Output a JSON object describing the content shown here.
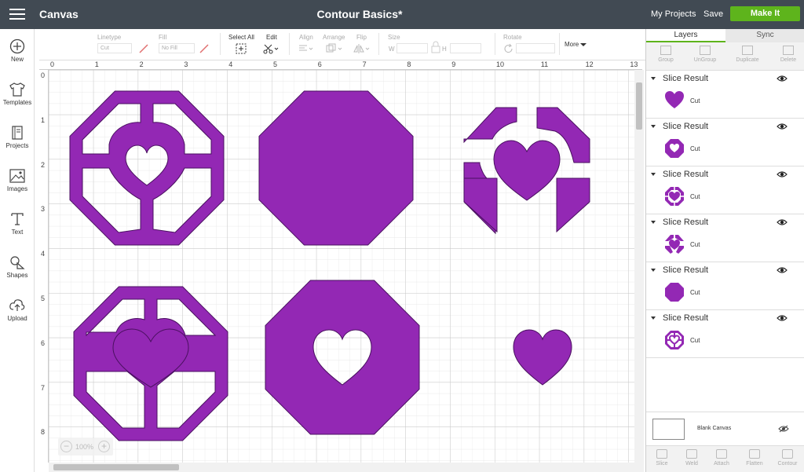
{
  "header": {
    "app_title": "Canvas",
    "project_title": "Contour Basics*",
    "my_projects": "My Projects",
    "save": "Save",
    "make_it": "Make It"
  },
  "sidebar": {
    "items": [
      {
        "label": "New",
        "icon": "plus-circle-icon"
      },
      {
        "label": "Templates",
        "icon": "shirt-icon"
      },
      {
        "label": "Projects",
        "icon": "book-icon"
      },
      {
        "label": "Images",
        "icon": "image-icon"
      },
      {
        "label": "Text",
        "icon": "text-t-icon"
      },
      {
        "label": "Shapes",
        "icon": "shapes-icon"
      },
      {
        "label": "Upload",
        "icon": "cloud-upload-icon"
      }
    ]
  },
  "toolbar": {
    "linetype_label": "Linetype",
    "linetype_value": "Cut",
    "fill_label": "Fill",
    "fill_value": "No Fill",
    "select_all": "Select All",
    "edit": "Edit",
    "align": "Align",
    "arrange": "Arrange",
    "flip": "Flip",
    "size": "Size",
    "w": "W",
    "h": "H",
    "rotate": "Rotate",
    "more": "More"
  },
  "rulers": {
    "top": [
      "0",
      "1",
      "2",
      "3",
      "4",
      "5",
      "6",
      "7",
      "8",
      "9",
      "10",
      "11",
      "12",
      "13"
    ],
    "left": [
      "0",
      "1",
      "2",
      "3",
      "4",
      "5",
      "6",
      "7",
      "8"
    ]
  },
  "zoom": {
    "value": "100%",
    "minus": "−",
    "plus": "+"
  },
  "panel": {
    "tabs": [
      "Layers",
      "Sync"
    ],
    "tools": [
      "Group",
      "UnGroup",
      "Duplicate",
      "Delete"
    ],
    "layers": [
      {
        "name": "Slice Result",
        "linetype": "Cut",
        "thumb": "heart"
      },
      {
        "name": "Slice Result",
        "linetype": "Cut",
        "thumb": "octagon-heart-cutout"
      },
      {
        "name": "Slice Result",
        "linetype": "Cut",
        "thumb": "frame-heart"
      },
      {
        "name": "Slice Result",
        "linetype": "Cut",
        "thumb": "corners-heart"
      },
      {
        "name": "Slice Result",
        "linetype": "Cut",
        "thumb": "octagon"
      },
      {
        "name": "Slice Result",
        "linetype": "Cut",
        "thumb": "frame"
      }
    ],
    "blank_canvas": "Blank Canvas",
    "bottom_tools": [
      "Slice",
      "Weld",
      "Attach",
      "Flatten",
      "Contour"
    ]
  },
  "colors": {
    "shape_fill": "#9328b4",
    "shape_stroke": "#4a1060",
    "accent_green": "#5eb41c",
    "header_bg": "#414a53"
  }
}
